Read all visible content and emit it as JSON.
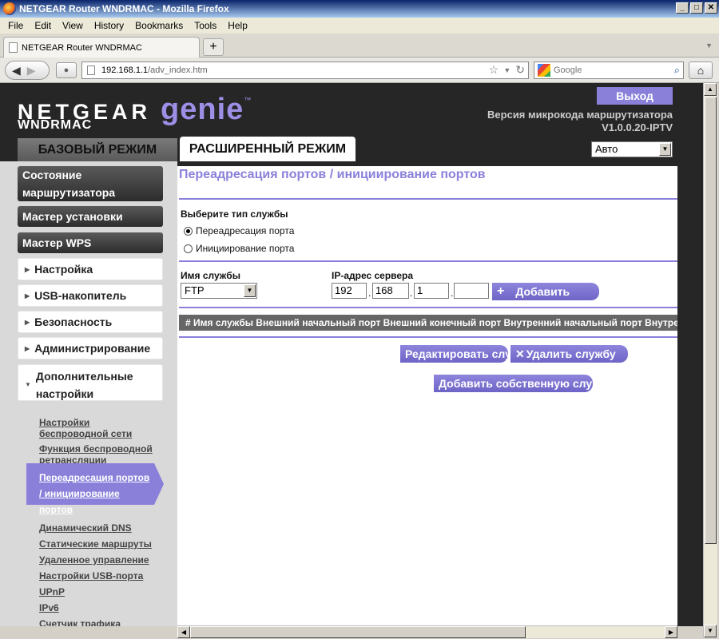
{
  "browser": {
    "title": "NETGEAR Router WNDRMAC - Mozilla Firefox",
    "menu": [
      "File",
      "Edit",
      "View",
      "History",
      "Bookmarks",
      "Tools",
      "Help"
    ],
    "tab_title": "NETGEAR Router WNDRMAC",
    "url_host": "192.168.1.1",
    "url_path": "/adv_index.htm",
    "search_placeholder": "Google"
  },
  "header": {
    "brand": "NETGEAR",
    "genie": "genie",
    "tm": "™",
    "model": "WNDRMAC",
    "logout": "Выход",
    "firmware_label": "Версия микрокода маршрутизатора",
    "firmware_version": "V1.0.0.20-IPTV",
    "tab_basic": "БАЗОВЫЙ РЕЖИМ",
    "tab_advanced": "РАСШИРЕННЫЙ РЕЖИМ",
    "language": "Авто"
  },
  "sidebar": {
    "router_status_1": "Состояние",
    "router_status_2": "маршрутизатора",
    "setup_wizard": "Мастер установки",
    "wps_wizard": "Мастер WPS",
    "setup": "Настройка",
    "usb": "USB-накопитель",
    "security": "Безопасность",
    "admin": "Администрирование",
    "advanced_1": "Дополнительные",
    "advanced_2": "настройки",
    "sub_wireless_1": "Настройки",
    "sub_wireless_2": "беспроводной сети",
    "sub_repeater_1": "Функция беспроводной",
    "sub_repeater_2": "ретрансляции",
    "sub_active_1": "Переадресация портов",
    "sub_active_2": "/ инициирование портов",
    "sub_ddns": "Динамический DNS",
    "sub_static": "Статические маршруты",
    "sub_remote": "Удаленное управление",
    "sub_usb": "Настройки USB-порта",
    "sub_upnp": "UPnP",
    "sub_ipv6": "IPv6",
    "sub_traffic": "Счетчик трафика"
  },
  "main": {
    "title": "Переадресация портов / инициирование портов",
    "service_type_label": "Выберите тип службы",
    "opt_forwarding": "Переадресация порта",
    "opt_triggering": "Инициирование порта",
    "service_name_label": "Имя службы",
    "server_ip_label": "IP-адрес сервера",
    "service_value": "FTP",
    "ip1": "192",
    "ip2": "168",
    "ip3": "1",
    "ip4": "",
    "add_button": "Добавить",
    "table_header": "# Имя службы Внешний начальный порт Внешний конечный порт Внутренний начальный порт Внутренн",
    "edit_button": "Редактировать службу",
    "delete_button": "Удалить службу",
    "add_custom_button": "Добавить собственную службу"
  },
  "colors": {
    "accent": "#8a80da",
    "header_bg": "#262626",
    "sidebar_bg": "#d9d9d9"
  }
}
